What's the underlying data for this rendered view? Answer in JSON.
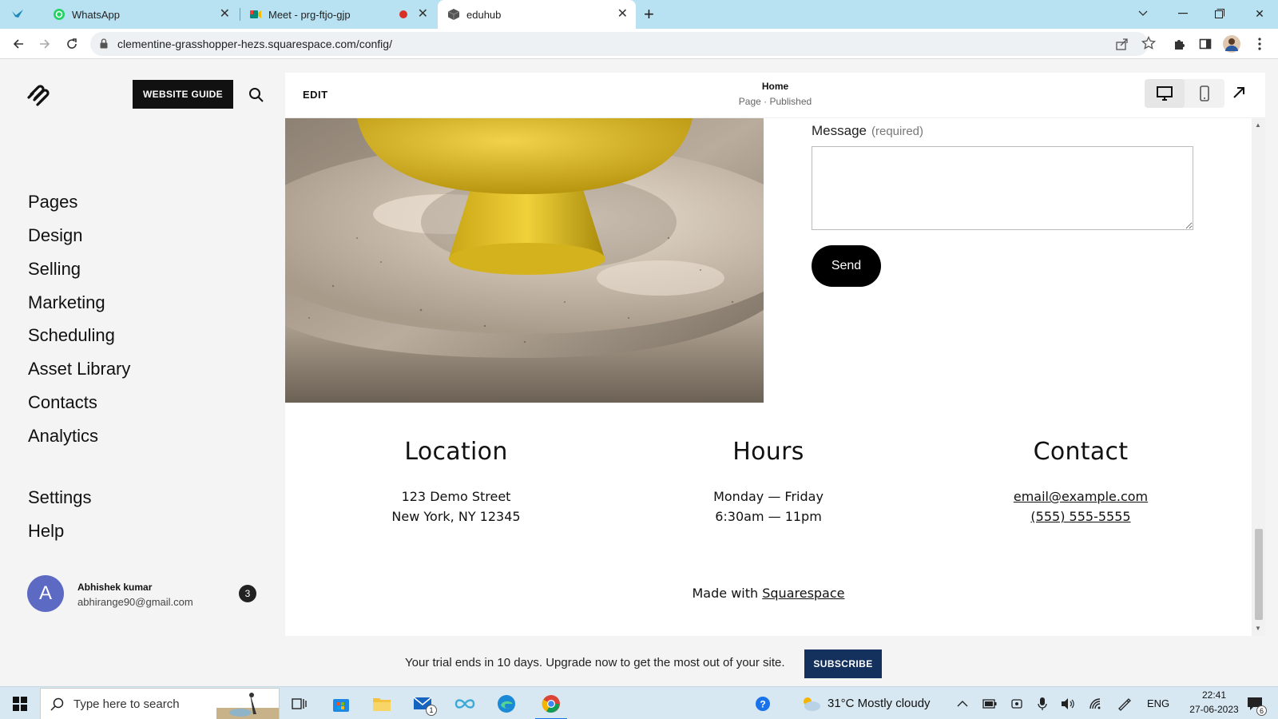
{
  "browser": {
    "tabs": [
      {
        "label": "WhatsApp",
        "icon": "whatsapp-icon"
      },
      {
        "label": "Meet - prg-ftjo-gjp",
        "icon": "meet-icon",
        "recording": true
      },
      {
        "label": "eduhub",
        "icon": "squarespace-cube-icon",
        "active": true
      }
    ],
    "new_tab": "+",
    "url": "clementine-grasshopper-hezs.squarespace.com/config/"
  },
  "sidebar": {
    "guide_button": "WEBSITE GUIDE",
    "nav": [
      "Pages",
      "Design",
      "Selling",
      "Marketing",
      "Scheduling",
      "Asset Library",
      "Contacts",
      "Analytics"
    ],
    "nav_secondary": [
      "Settings",
      "Help"
    ],
    "user": {
      "initial": "A",
      "name": "Abhishek kumar",
      "email": "abhirange90@gmail.com",
      "notifications": "3"
    }
  },
  "editor": {
    "edit_label": "EDIT",
    "page_title": "Home",
    "page_status": "Page · Published",
    "form": {
      "message_label": "Message",
      "required_label": "(required)",
      "send_label": "Send"
    },
    "footer": {
      "location": {
        "title": "Location",
        "line1": "123 Demo Street",
        "line2": "New York, NY 12345"
      },
      "hours": {
        "title": "Hours",
        "line1": "Monday — Friday",
        "line2": "6:30am — 11pm"
      },
      "contact": {
        "title": "Contact",
        "email": "email@example.com",
        "phone": "(555) 555-5555"
      },
      "made_with_prefix": "Made with",
      "made_with_link": "Squarespace"
    }
  },
  "trial": {
    "text": "Your trial ends in 10 days. Upgrade now to get the most out of your site.",
    "subscribe": "SUBSCRIBE"
  },
  "taskbar": {
    "search_placeholder": "Type here to search",
    "weather": "31°C  Mostly cloudy",
    "language": "ENG",
    "time": "22:41",
    "date": "27-06-2023",
    "mail_badge": "1",
    "notification_badge": "6"
  },
  "colors": {
    "tabstrip": "#b8e2f2",
    "subscribe_button": "#13315c",
    "avatar": "#5c6ac4",
    "send_button": "#000000"
  }
}
